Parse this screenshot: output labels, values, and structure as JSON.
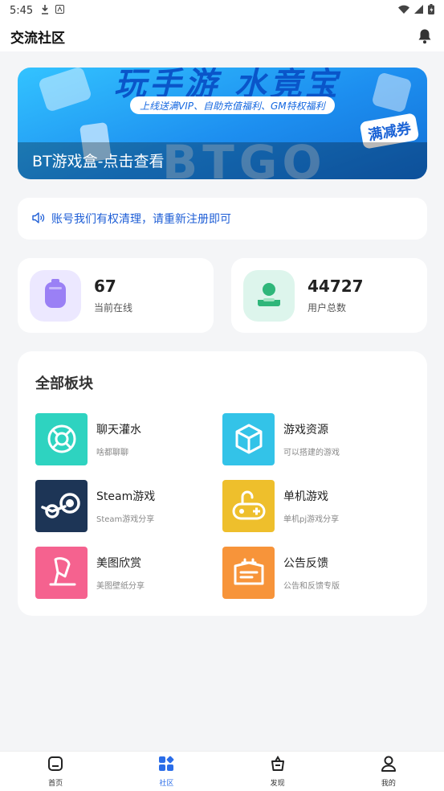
{
  "status_bar": {
    "time": "5:45"
  },
  "top_bar": {
    "title": "交流社区"
  },
  "banner": {
    "headline": "玩手游  水竟宝",
    "pill": "上线送满VIP、自助充值福利、GM特权福利",
    "big_text": "BTGO",
    "badge": "满减券",
    "caption": "BT游戏盒-点击查看"
  },
  "notice": {
    "text": "账号我们有权清理，请重新注册即可"
  },
  "stats": [
    {
      "value": "67",
      "label": "当前在线",
      "bg": "#ece8ff",
      "color": "#9a80f5"
    },
    {
      "value": "44727",
      "label": "用户总数",
      "bg": "#ddf5ec",
      "color": "#2fb67a"
    }
  ],
  "boards_section": {
    "title": "全部板块",
    "items": [
      {
        "name": "聊天灌水",
        "desc": "啥都聊聊",
        "icon": "lifebuoy-icon",
        "color": "#2ed3c0"
      },
      {
        "name": "游戏资源",
        "desc": "可以搭建的游戏",
        "icon": "cube-icon",
        "color": "#33c3e8"
      },
      {
        "name": "Steam游戏",
        "desc": "Steam游戏分享",
        "icon": "steam-icon",
        "color": "#1d3556"
      },
      {
        "name": "单机游戏",
        "desc": "单机pj游戏分享",
        "icon": "gamepad-icon",
        "color": "#eebf2c"
      },
      {
        "name": "美图欣赏",
        "desc": "美图壁纸分享",
        "icon": "popsicle-icon",
        "color": "#f5628f"
      },
      {
        "name": "公告反馈",
        "desc": "公告和反馈专版",
        "icon": "notice-board-icon",
        "color": "#f7943a"
      }
    ]
  },
  "tabs": [
    {
      "label": "首页",
      "icon": "home-icon",
      "active": false
    },
    {
      "label": "社区",
      "icon": "community-icon",
      "active": true
    },
    {
      "label": "发现",
      "icon": "discover-icon",
      "active": false
    },
    {
      "label": "我的",
      "icon": "profile-icon",
      "active": false
    }
  ],
  "colors": {
    "accent": "#2b6de8",
    "notice_text": "#1e5ed6"
  }
}
